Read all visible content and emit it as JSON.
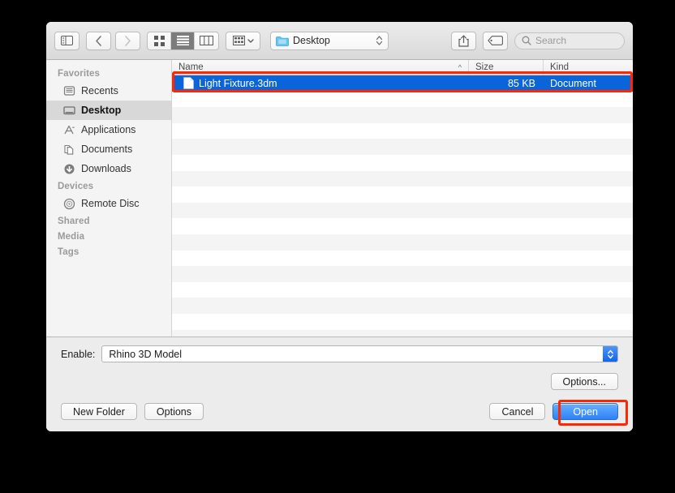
{
  "window": {
    "title": "Open file dialog"
  },
  "toolbar": {
    "sidebar_toggle": "sidebar-toggle",
    "back_label": "Back",
    "forward_label": "Forward",
    "view_icon_label": "Icon view",
    "view_list_label": "List view",
    "view_column_label": "Column view",
    "group_label": "Arrange by",
    "path_label": "Desktop",
    "share_label": "Share",
    "tag_label": "Edit tags",
    "search_placeholder": "Search"
  },
  "sidebar": {
    "groups": [
      {
        "title": "Favorites",
        "items": [
          {
            "label": "Recents",
            "icon": "recents-icon",
            "selected": false
          },
          {
            "label": "Desktop",
            "icon": "desktop-icon",
            "selected": true
          },
          {
            "label": "Applications",
            "icon": "applications-icon",
            "selected": false
          },
          {
            "label": "Documents",
            "icon": "documents-icon",
            "selected": false
          },
          {
            "label": "Downloads",
            "icon": "downloads-icon",
            "selected": false
          }
        ]
      },
      {
        "title": "Devices",
        "items": [
          {
            "label": "Remote Disc",
            "icon": "remote-disc-icon",
            "selected": false
          }
        ]
      },
      {
        "title": "Shared",
        "items": []
      },
      {
        "title": "Media",
        "items": []
      },
      {
        "title": "Tags",
        "items": []
      }
    ]
  },
  "filelist": {
    "columns": {
      "name": "Name",
      "size": "Size",
      "kind": "Kind"
    },
    "sort_indicator": "^",
    "rows": [
      {
        "name": "Light Fixture.3dm",
        "size": "85 KB",
        "kind": "Document",
        "selected": true
      }
    ],
    "empty_row_count": 16
  },
  "bottom": {
    "enable_label": "Enable:",
    "enable_value": "Rhino 3D Model",
    "options_ellipsis_label": "Options...",
    "new_folder_label": "New Folder",
    "options_label": "Options",
    "cancel_label": "Cancel",
    "open_label": "Open"
  },
  "colors": {
    "selection_blue": "#0a65da",
    "default_button_blue": "#2c81f5",
    "annotation_red": "#ff2600",
    "stepper_blue": "#1565e8"
  }
}
